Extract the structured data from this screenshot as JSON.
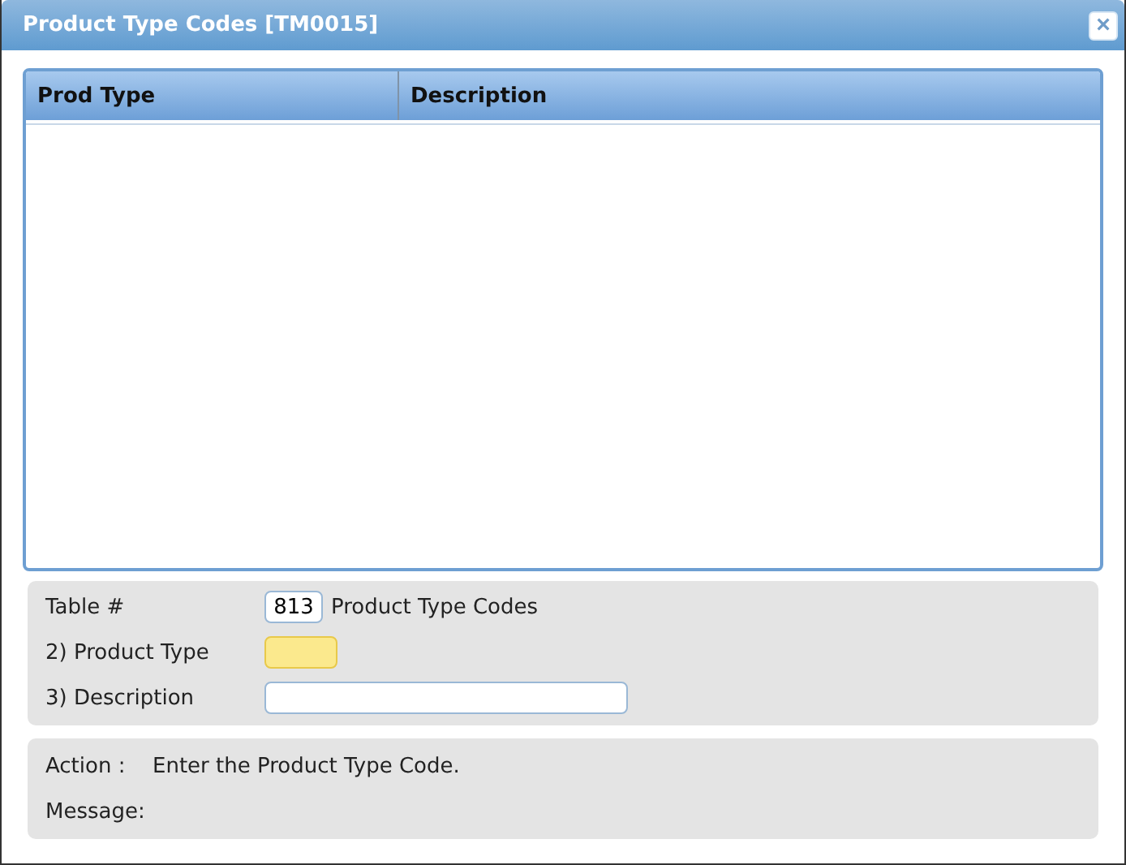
{
  "window": {
    "title": "Product Type Codes [TM0015]",
    "close": "×"
  },
  "table": {
    "columns": [
      {
        "label": "Prod Type"
      },
      {
        "label": "Description"
      }
    ]
  },
  "form": {
    "table_label": "Table #",
    "table_value": "813",
    "table_name": "Product Type Codes",
    "fields": [
      {
        "label": "2) Product Type",
        "kind": "short",
        "focused": true
      },
      {
        "label": "3) Description",
        "kind": "long",
        "focused": false
      }
    ]
  },
  "status": {
    "action_label": "Action :",
    "action_text": "Enter the Product Type Code.",
    "message_label": "Message:"
  }
}
